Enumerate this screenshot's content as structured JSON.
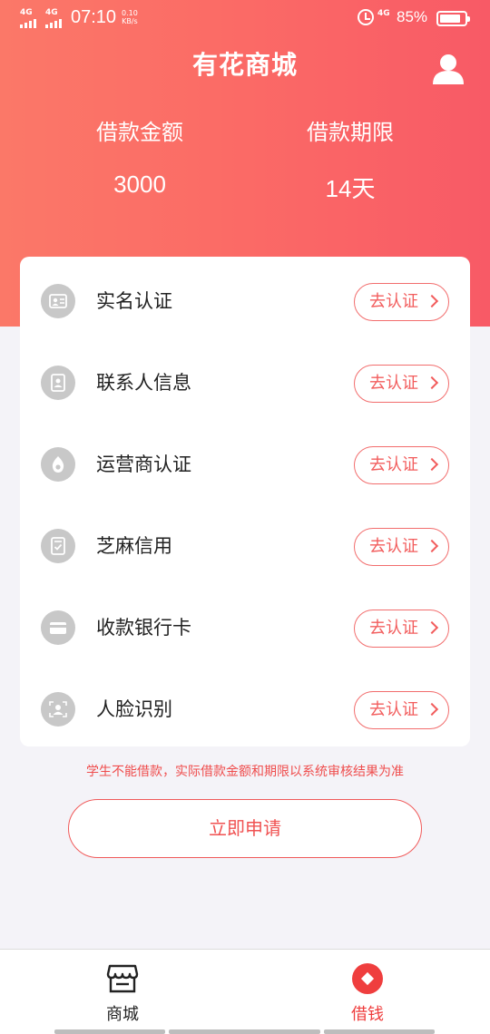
{
  "status_bar": {
    "sim1": "4G",
    "sim2": "4G",
    "time": "07:10",
    "speed_value": "0.10",
    "speed_unit": "KB/s",
    "network": "4G",
    "battery_percent": "85%",
    "battery_level": 0.85
  },
  "header": {
    "title": "有花商城",
    "profile_icon": "user-icon"
  },
  "loan": {
    "amount_label": "借款金额",
    "amount_value": "3000",
    "term_label": "借款期限",
    "term_value": "14天"
  },
  "verifications": [
    {
      "label": "实名认证",
      "icon": "id-card-icon",
      "action": "去认证"
    },
    {
      "label": "联系人信息",
      "icon": "contact-book-icon",
      "action": "去认证"
    },
    {
      "label": "运营商认证",
      "icon": "carrier-icon",
      "action": "去认证"
    },
    {
      "label": "芝麻信用",
      "icon": "credit-doc-icon",
      "action": "去认证"
    },
    {
      "label": "收款银行卡",
      "icon": "bank-card-icon",
      "action": "去认证"
    },
    {
      "label": "人脸识别",
      "icon": "face-scan-icon",
      "action": "去认证"
    }
  ],
  "notice": "学生不能借款，实际借款金额和期限以系统审核结果为准",
  "apply_button": "立即申请",
  "bottom_nav": [
    {
      "label": "商城",
      "icon": "shop-icon",
      "active": false
    },
    {
      "label": "借钱",
      "icon": "borrow-icon",
      "active": true
    }
  ],
  "colors": {
    "header_gradient_start": "#fb7868",
    "header_gradient_end": "#f85a66",
    "accent": "#f25d5d",
    "nav_active": "#ef3e3e",
    "icon_gray": "#c8c8c8"
  }
}
